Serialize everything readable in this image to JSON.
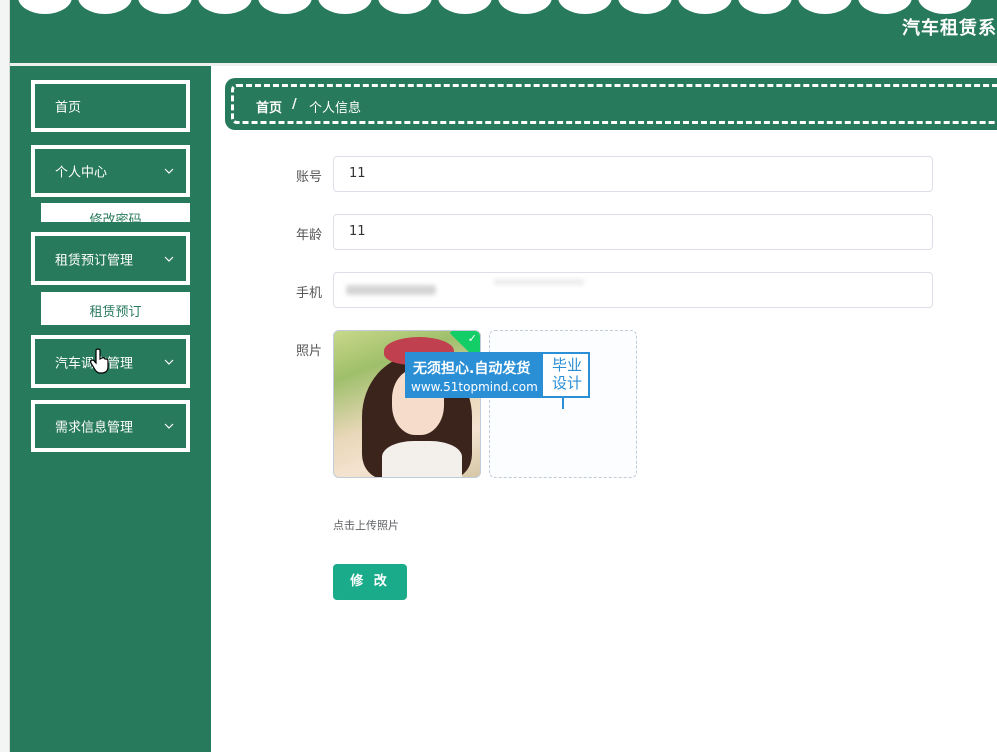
{
  "header": {
    "site_title": "汽车租赁系"
  },
  "sidebar": {
    "items": [
      {
        "label": "首页"
      },
      {
        "label": "个人中心",
        "sub": "修改密码"
      },
      {
        "label": "租赁预订管理",
        "sub": "租赁预订"
      },
      {
        "label": "汽车调度管理"
      },
      {
        "label": "需求信息管理"
      }
    ]
  },
  "breadcrumb": {
    "home": "首页",
    "separator": "/",
    "current": "个人信息"
  },
  "form": {
    "account_label": "账号",
    "account_value": "11",
    "age_label": "年龄",
    "age_value": "11",
    "phone_label": "手机",
    "photo_label": "照片",
    "upload_hint": "点击上传照片",
    "submit_label": "修 改"
  },
  "watermark": {
    "line1": "无须担心.自动发货",
    "line2": "www.51topmind.com",
    "right": "毕业 设计"
  },
  "colors": {
    "primary": "#287a5c",
    "button": "#1aab8a",
    "watermark": "#2b8fd6"
  }
}
